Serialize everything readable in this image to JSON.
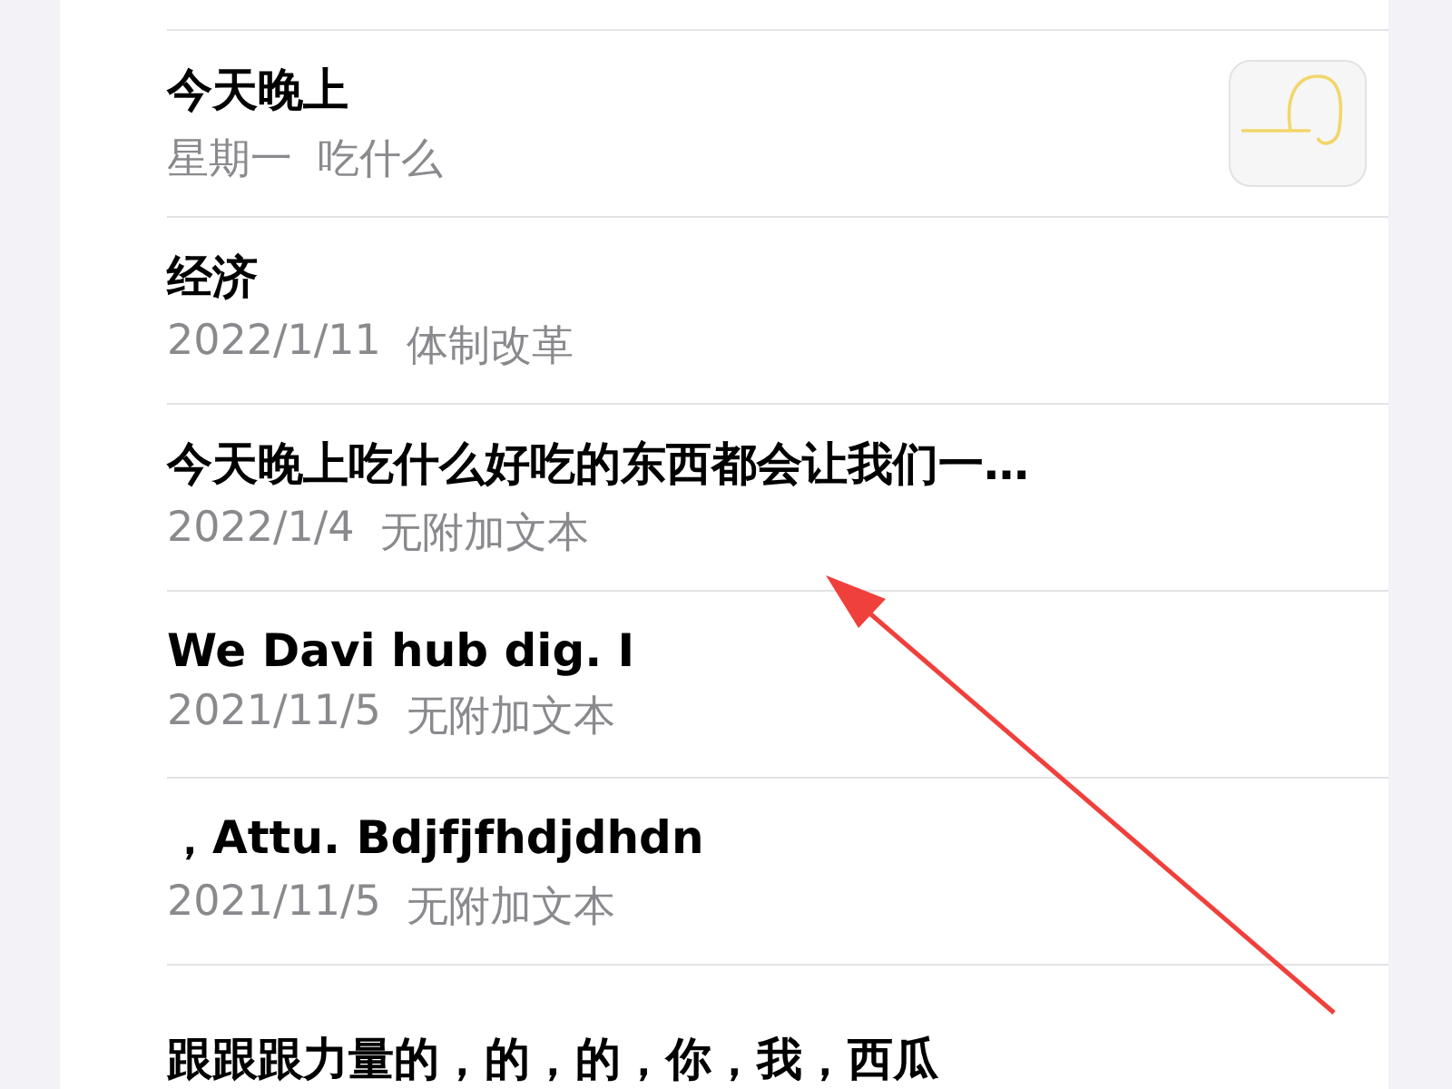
{
  "notes": [
    {
      "title": "今天晚上",
      "date": "星期一",
      "preview": "吃什么",
      "thumbnail": true
    },
    {
      "title": "经济",
      "date": "2022/1/11",
      "preview": "体制改革",
      "thumbnail": false
    },
    {
      "title": "今天晚上吃什么好吃的东西都会让我们一…",
      "date": "2022/1/4",
      "preview": "无附加文本",
      "thumbnail": false
    },
    {
      "title": "We Davi hub dig. I",
      "date": "2021/11/5",
      "preview": "无附加文本",
      "thumbnail": false
    },
    {
      "title": "，Attu.  Bdjfjfhdjdhdn",
      "date": "2021/11/5",
      "preview": "无附加文本",
      "thumbnail": false
    },
    {
      "title": "跟跟跟力量的，的，的，你，我，西瓜",
      "thumbnail": false
    }
  ]
}
